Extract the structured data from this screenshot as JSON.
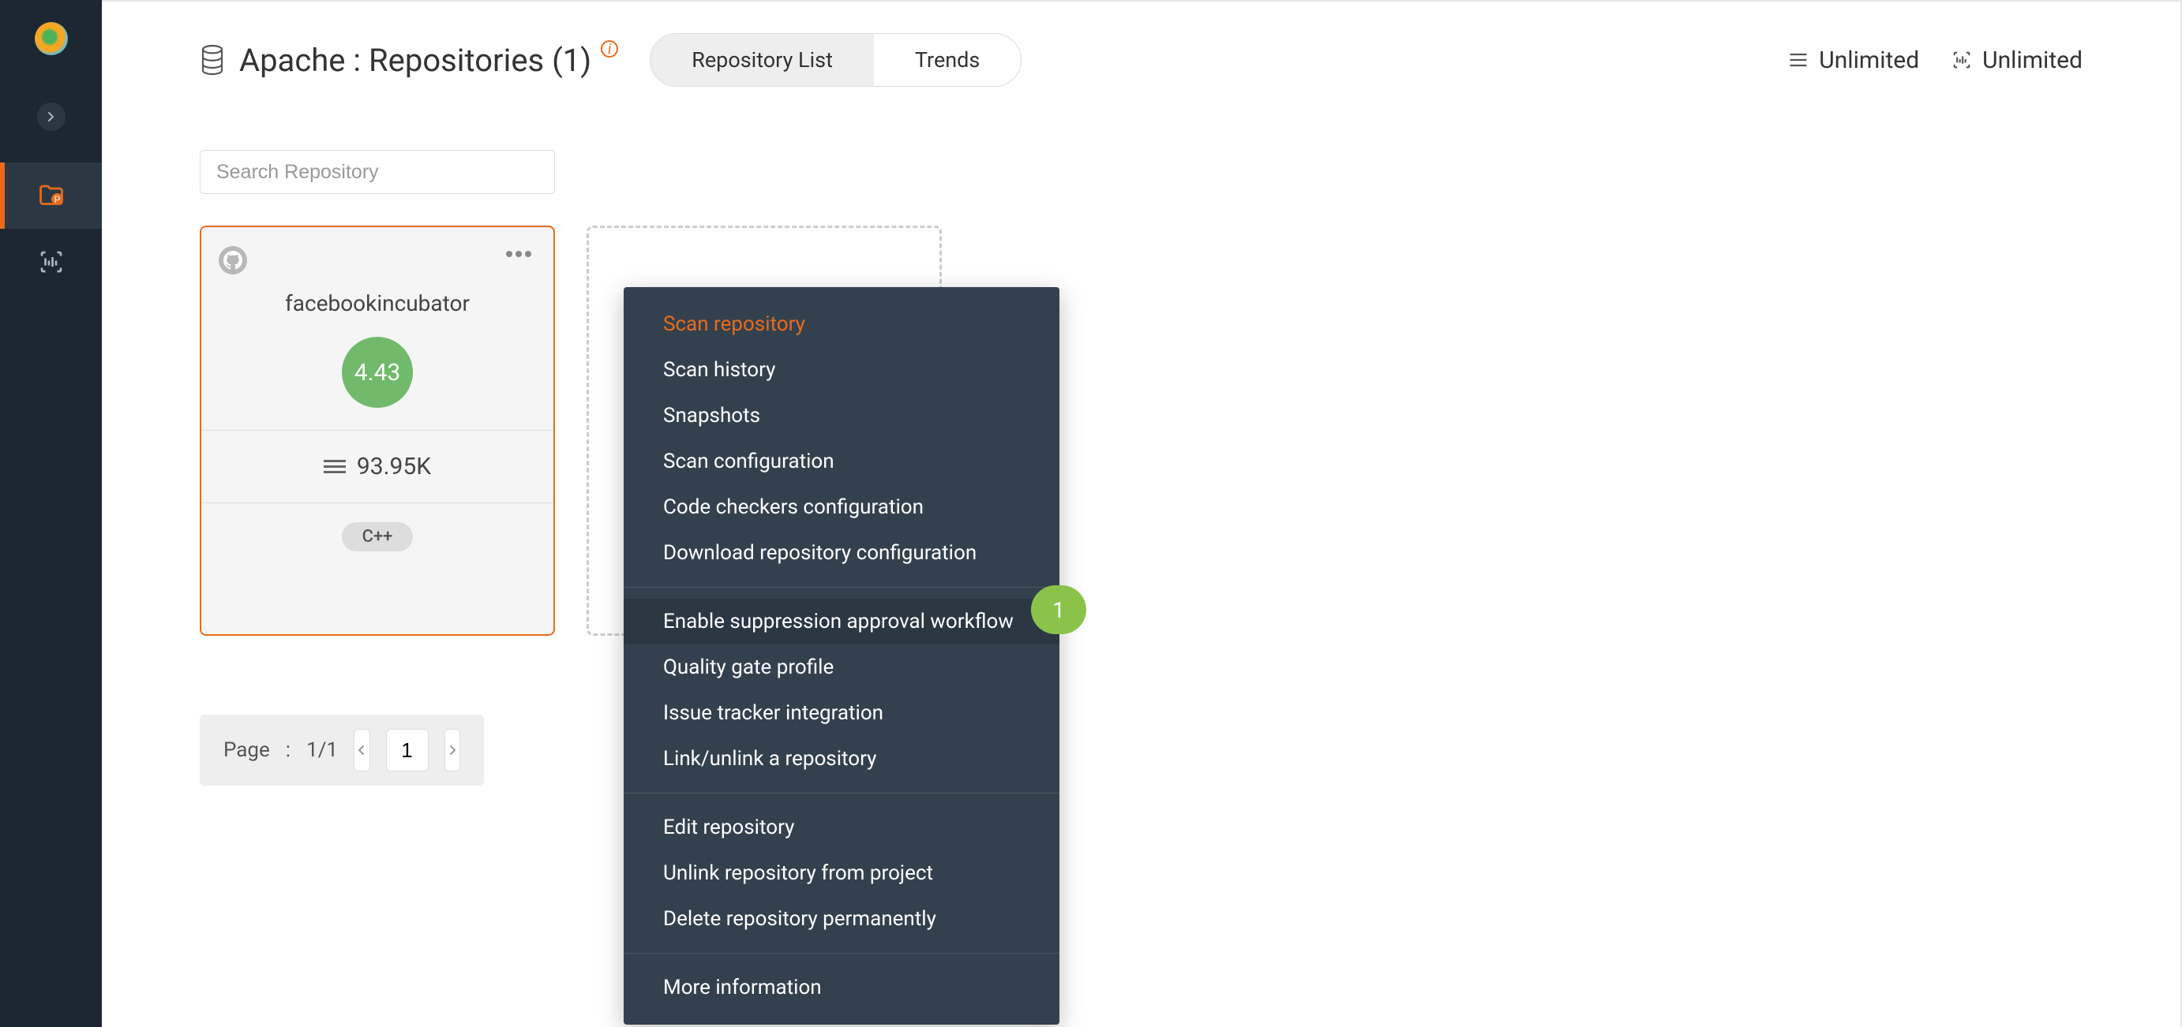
{
  "page": {
    "title": "Apache : Repositories (1)"
  },
  "tabs": {
    "repo_list": "Repository List",
    "trends": "Trends"
  },
  "limits": {
    "scan": "Unlimited",
    "loc": "Unlimited"
  },
  "search": {
    "placeholder": "Search Repository"
  },
  "repo": {
    "name": "facebookincubator",
    "rating": "4.43",
    "loc": "93.95K",
    "language": "C++"
  },
  "pagination": {
    "label": "Page",
    "colon": ":",
    "total": "1/1",
    "current": "1"
  },
  "menu": {
    "scan_repository": "Scan repository",
    "scan_history": "Scan history",
    "snapshots": "Snapshots",
    "scan_configuration": "Scan configuration",
    "code_checkers": "Code checkers configuration",
    "download_config": "Download repository configuration",
    "enable_suppression": "Enable suppression approval workflow",
    "quality_gate": "Quality gate profile",
    "issue_tracker": "Issue tracker integration",
    "link_unlink": "Link/unlink a repository",
    "edit_repository": "Edit repository",
    "unlink_repository": "Unlink repository from project",
    "delete_repository": "Delete repository permanently",
    "more_information": "More information",
    "badge": "1"
  }
}
